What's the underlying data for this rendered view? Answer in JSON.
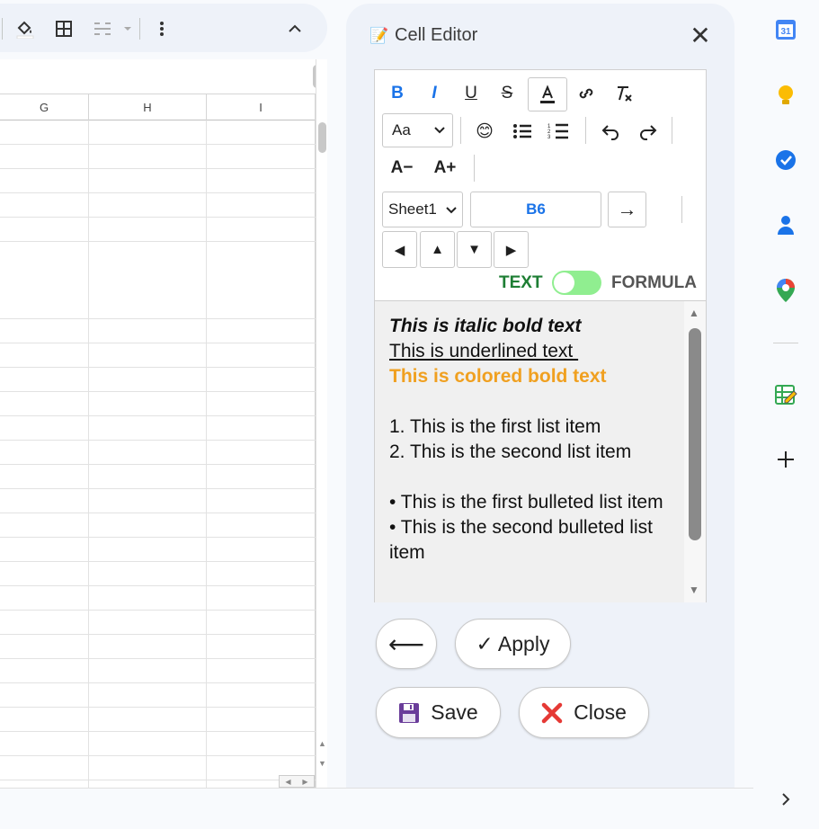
{
  "sheet": {
    "columns": [
      "G",
      "H",
      "I"
    ],
    "toolbar_icons": [
      "paint-fill-icon",
      "borders-icon",
      "merge-cells-icon",
      "more-vert-icon",
      "collapse-icon"
    ]
  },
  "panel": {
    "title": "Cell Editor",
    "close_glyph": "✕"
  },
  "editor": {
    "font_select": "Aa",
    "sheet_select": "Sheet1",
    "cell_ref": "B6",
    "go_arrow": "→",
    "dec_font": "A−",
    "inc_font": "A+",
    "nav": [
      "◀",
      "▲",
      "▼",
      "▶"
    ],
    "mode_text": "TEXT",
    "mode_formula": "FORMULA",
    "content": {
      "line1": "This is italic bold text",
      "line2": "This is underlined text ",
      "line3": "This is colored bold text",
      "line4": "1. This is the first list item",
      "line5": "2. This is the second list item",
      "line6": "• This is the first bulleted list item",
      "line7": "• This is the second bulleted list item"
    },
    "colors": {
      "colored_text": "#f0a020",
      "mode_text": "#1e7e34",
      "cell_ref": "#1a73e8"
    }
  },
  "actions": {
    "back": "⟵",
    "apply": "✓ Apply",
    "save": "Save",
    "close": "Close"
  },
  "rail": {
    "calendar_day": "31"
  }
}
